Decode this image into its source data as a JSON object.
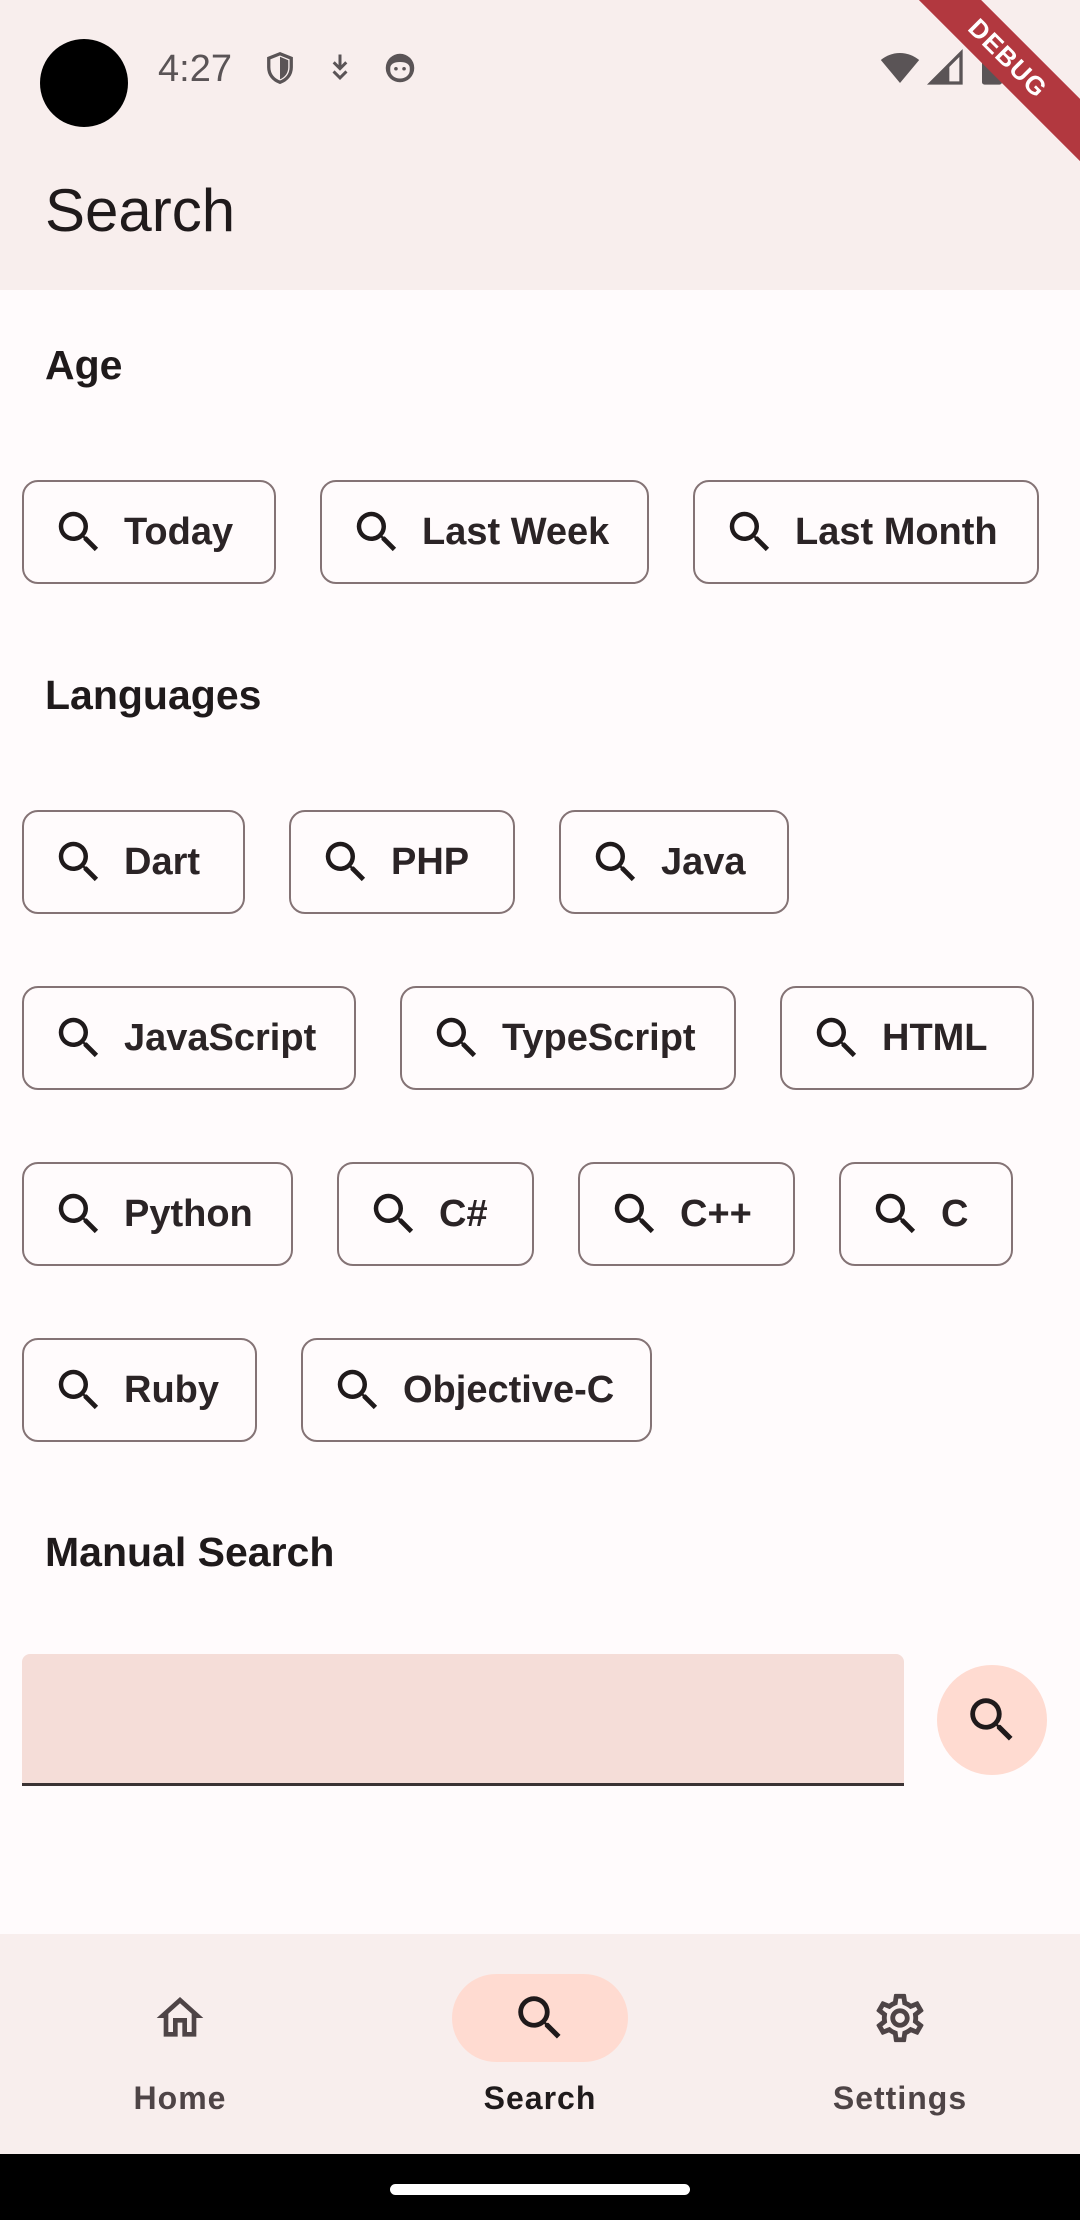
{
  "status_bar": {
    "time": "4:27",
    "left_icons": [
      "shield-icon",
      "download-icon",
      "face-icon"
    ],
    "right_icons": [
      "wifi-icon",
      "signal-icon",
      "battery-icon"
    ]
  },
  "debug_banner": "DEBUG",
  "app_bar": {
    "title": "Search"
  },
  "sections": {
    "age": {
      "title": "Age",
      "chips": [
        "Today",
        "Last Week",
        "Last Month"
      ]
    },
    "languages": {
      "title": "Languages",
      "chips": [
        "Dart",
        "PHP",
        "Java",
        "JavaScript",
        "TypeScript",
        "HTML",
        "Python",
        "C#",
        "C++",
        "C",
        "Ruby",
        "Objective-C"
      ]
    },
    "manual": {
      "title": "Manual Search",
      "input_value": "",
      "button_icon": "search-icon"
    }
  },
  "bottom_nav": {
    "items": [
      {
        "label": "Home",
        "icon": "home-icon",
        "active": false
      },
      {
        "label": "Search",
        "icon": "search-icon",
        "active": true
      },
      {
        "label": "Settings",
        "icon": "gear-icon",
        "active": false
      }
    ]
  },
  "colors": {
    "surface": "#f8eeed",
    "background": "#fffbfc",
    "chip_border": "#847375",
    "input_fill": "#f5ddd8",
    "accent_container": "#ffdbd1",
    "debug_banner": "#b2383f"
  }
}
